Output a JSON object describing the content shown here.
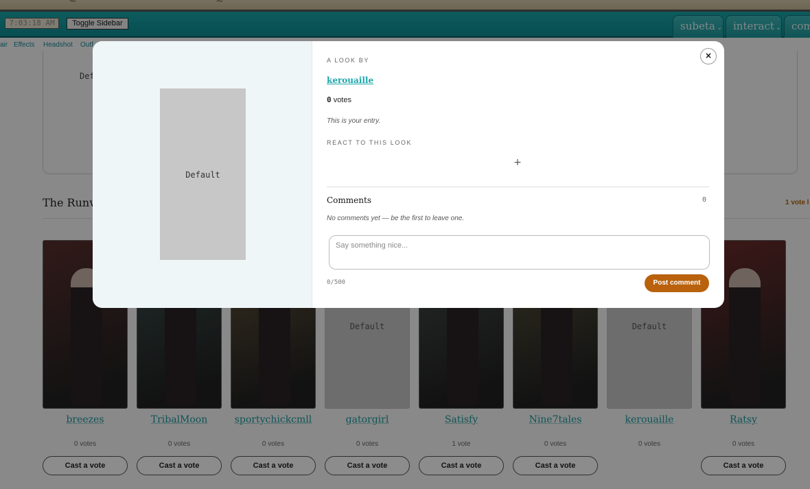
{
  "toolbar": {
    "clock": "7:03:18 AM",
    "toggle_sidebar": "Toggle Sidebar",
    "tabs": [
      {
        "label": "subeta"
      },
      {
        "label": "interact"
      },
      {
        "label": "com"
      }
    ]
  },
  "subnav": [
    "air",
    "Effects",
    "Headshot",
    "Outf"
  ],
  "page": {
    "prev_card_default": "Default",
    "section_title": "The Runwa",
    "section_votes": "1 vote l",
    "entries": [
      {
        "name": "breezes",
        "votes": "0 votes",
        "cast": "Cast a vote",
        "placeholder": false,
        "color": "#5a2f2f"
      },
      {
        "name": "TribalMoon",
        "votes": "0 votes",
        "cast": "Cast a vote",
        "placeholder": false,
        "color": "#3f5552"
      },
      {
        "name": "sportychickcmll",
        "votes": "0 votes",
        "cast": "Cast a vote",
        "placeholder": false,
        "color": "#6c5a3c"
      },
      {
        "name": "gatorgirl",
        "votes": "0 votes",
        "cast": "Cast a vote",
        "placeholder": true,
        "default_label": "Default"
      },
      {
        "name": "Satisfy",
        "votes": "1 vote",
        "cast": "Cast a vote",
        "placeholder": false,
        "color": "#4c5250"
      },
      {
        "name": "Nine7tales",
        "votes": "0 votes",
        "cast": "Cast a vote",
        "placeholder": false,
        "color": "#5d5a3e"
      },
      {
        "name": "kerouaille",
        "votes": "0 votes",
        "cast": "",
        "placeholder": true,
        "default_label": "Default"
      },
      {
        "name": "Ratsy",
        "votes": "0 votes",
        "cast": "Cast a vote",
        "placeholder": false,
        "color": "#6e2b2b"
      }
    ]
  },
  "modal": {
    "preview_label": "Default",
    "eyebrow_look_by": "A LOOK BY",
    "author": "kerouaille",
    "vote_count": "0",
    "vote_suffix": "votes",
    "entry_note": "This is your entry.",
    "react_heading": "REACT TO THIS LOOK",
    "react_add": "+",
    "comments_title": "Comments",
    "comments_count": "0",
    "no_comments": "No comments yet — be the first to leave one.",
    "comment_placeholder": "Say something nice...",
    "char_count": "0/500",
    "post_button": "Post comment",
    "close": "×"
  }
}
